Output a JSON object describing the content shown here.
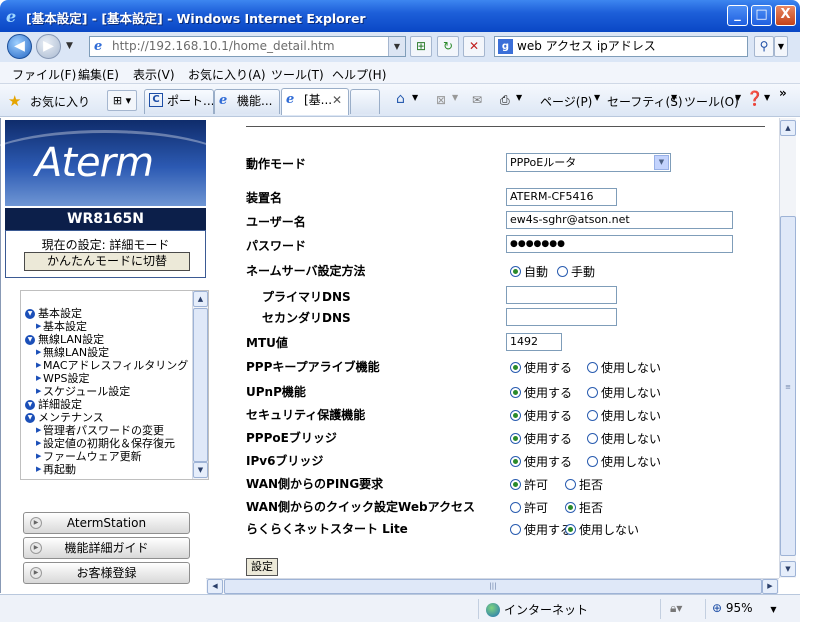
{
  "window": {
    "title": "[基本設定] - [基本設定] - Windows Internet Explorer",
    "min": "_",
    "max": "□",
    "close": "X"
  },
  "address": {
    "url": "http://192.168.10.1/home_detail.htm",
    "search_value": "web アクセス ipアドレス",
    "search_engine_icon": "g-search-icon"
  },
  "menu": [
    "ファイル(F)",
    "編集(E)",
    "表示(V)",
    "お気に入り(A)",
    "ツール(T)",
    "ヘルプ(H)"
  ],
  "favbar": {
    "favorites_label": "お気に入り",
    "tabs": [
      {
        "label": "ポート..."
      },
      {
        "label": "機能..."
      },
      {
        "label": "[基..."
      }
    ],
    "tools": {
      "page": "ページ(P)",
      "safety": "セーフティ(S)",
      "tools": "ツール(O)",
      "more": "»"
    }
  },
  "left": {
    "logo": "Aterm",
    "model": "WR8165N",
    "mode_text": "現在の設定: 詳細モード",
    "mode_button": "かんたんモードに切替",
    "nav": [
      {
        "type": "group",
        "label": "基本設定"
      },
      {
        "type": "sub",
        "label": "基本設定"
      },
      {
        "type": "group",
        "label": "無線LAN設定"
      },
      {
        "type": "sub",
        "label": "無線LAN設定"
      },
      {
        "type": "sub",
        "label": "MACアドレスフィルタリング"
      },
      {
        "type": "sub",
        "label": "WPS設定"
      },
      {
        "type": "sub",
        "label": "スケジュール設定"
      },
      {
        "type": "group",
        "label": "詳細設定"
      },
      {
        "type": "group",
        "label": "メンテナンス"
      },
      {
        "type": "sub",
        "label": "管理者パスワードの変更"
      },
      {
        "type": "sub",
        "label": "設定値の初期化＆保存復元"
      },
      {
        "type": "sub",
        "label": "ファームウェア更新"
      },
      {
        "type": "sub",
        "label": "再起動"
      }
    ],
    "buttons": [
      "AtermStation",
      "機能詳細ガイド",
      "お客様登録"
    ]
  },
  "form": {
    "mode_label": "動作モード",
    "mode_value": "PPPoEルータ",
    "device_name_label": "装置名",
    "device_name_value": "ATERM-CF5416",
    "user_label": "ユーザー名",
    "user_value": "ew4s-sghr@atson.net",
    "password_label": "パスワード",
    "password_value": "●●●●●●●",
    "dns_label": "ネームサーバ設定方法",
    "dns_auto": "自動",
    "dns_manual": "手動",
    "primary_dns_label": "プライマリDNS",
    "primary_dns_value": "",
    "secondary_dns_label": "セカンダリDNS",
    "secondary_dns_value": "",
    "mtu_label": "MTU値",
    "mtu_value": "1492",
    "use": "使用する",
    "nouse": "使用しない",
    "allow": "許可",
    "deny": "拒否",
    "rows": [
      {
        "label": "PPPキープアライブ機能",
        "left": "使用する",
        "right": "使用しない",
        "selected": "left"
      },
      {
        "label": "UPnP機能",
        "left": "使用する",
        "right": "使用しない",
        "selected": "left"
      },
      {
        "label": "セキュリティ保護機能",
        "left": "使用する",
        "right": "使用しない",
        "selected": "left"
      },
      {
        "label": "PPPoEブリッジ",
        "left": "使用する",
        "right": "使用しない",
        "selected": "left"
      },
      {
        "label": "IPv6ブリッジ",
        "left": "使用する",
        "right": "使用しない",
        "selected": "left"
      },
      {
        "label": "WAN側からのPING要求",
        "left": "許可",
        "right": "拒否",
        "selected": "left"
      },
      {
        "label": "WAN側からのクイック設定Webアクセス",
        "left": "許可",
        "right": "拒否",
        "selected": "right"
      },
      {
        "label": "らくらくネットスタート Lite",
        "left": "使用する",
        "right": "使用しない",
        "selected": "right"
      }
    ],
    "submit": "設定"
  },
  "status": {
    "zone": "インターネット",
    "zoom": "95%"
  }
}
